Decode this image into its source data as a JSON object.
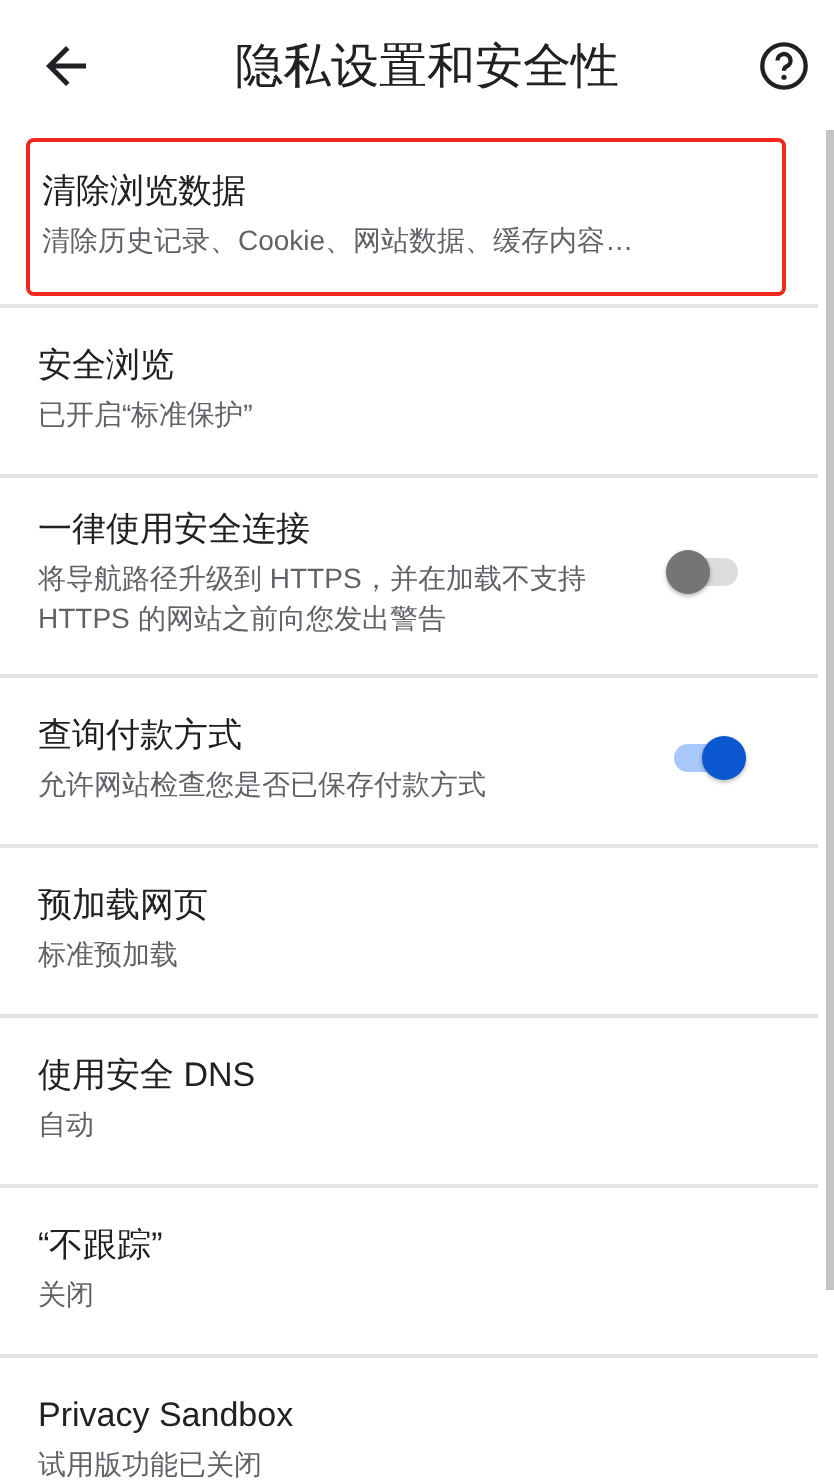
{
  "header": {
    "title": "隐私设置和安全性"
  },
  "items": [
    {
      "kind": "link",
      "title": "清除浏览数据",
      "summary": "清除历史记录、Cookie、网站数据、缓存内容…",
      "highlighted": true
    },
    {
      "kind": "link",
      "title": "安全浏览",
      "summary": "已开启“标准保护”",
      "highlighted": false
    },
    {
      "kind": "toggle",
      "title": "一律使用安全连接",
      "summary": "将导航路径升级到 HTTPS，并在加载不支持 HTTPS 的网站之前向您发出警告",
      "on": false,
      "highlighted": false
    },
    {
      "kind": "toggle",
      "title": "查询付款方式",
      "summary": "允许网站检查您是否已保存付款方式",
      "on": true,
      "highlighted": false
    },
    {
      "kind": "link",
      "title": "预加载网页",
      "summary": "标准预加载",
      "highlighted": false
    },
    {
      "kind": "link",
      "title": "使用安全 DNS",
      "summary": "自动",
      "highlighted": false
    },
    {
      "kind": "link",
      "title": "“不跟踪”",
      "summary": "关闭",
      "highlighted": false
    },
    {
      "kind": "link",
      "title": "Privacy Sandbox",
      "summary": "试用版功能已关闭",
      "highlighted": false
    }
  ]
}
